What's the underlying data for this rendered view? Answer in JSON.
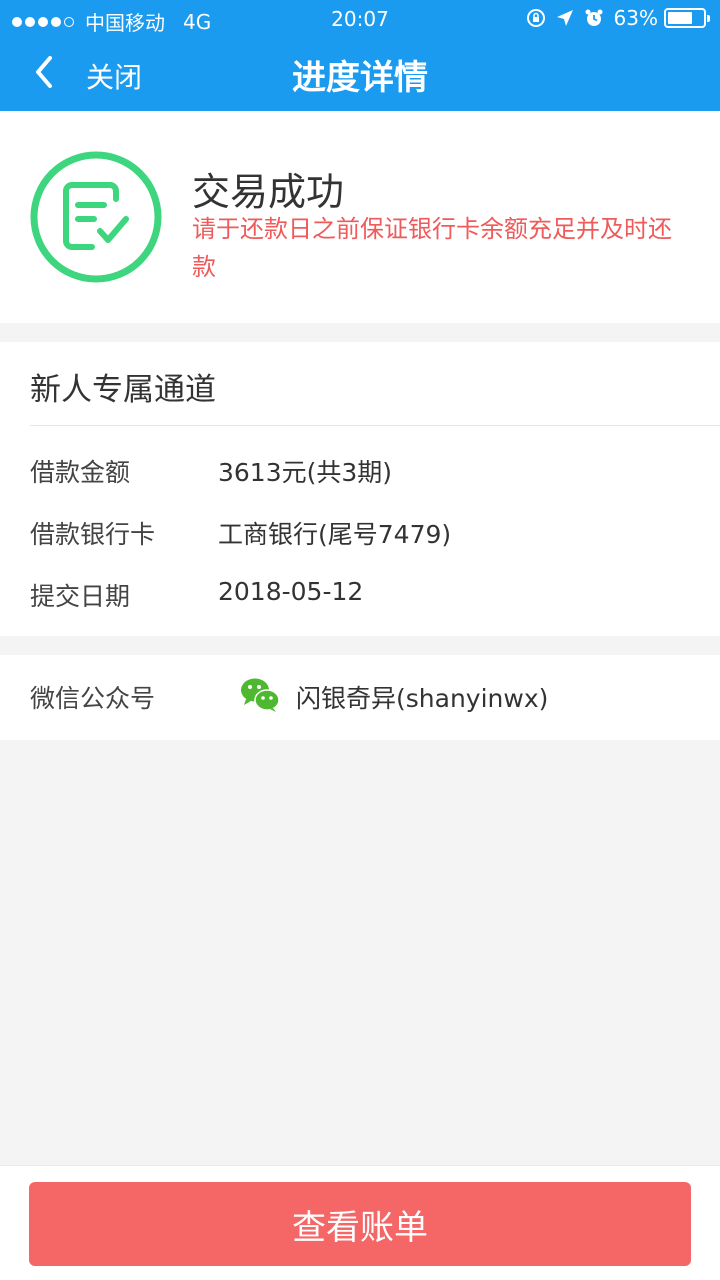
{
  "status_bar": {
    "carrier": "中国移动",
    "network": "4G",
    "time": "20:07",
    "battery": "63%"
  },
  "nav": {
    "close_label": "关闭",
    "title": "进度详情"
  },
  "result": {
    "title": "交易成功",
    "note": "请于还款日之前保证银行卡余额充足并及时还款"
  },
  "info": {
    "section_title": "新人专属通道",
    "rows": [
      {
        "label": "借款金额",
        "value": "3613元(共3期)"
      },
      {
        "label": "借款银行卡",
        "value": "工商银行(尾号7479)"
      },
      {
        "label": "提交日期",
        "value": "2018-05-12"
      }
    ]
  },
  "wechat": {
    "label": "微信公众号",
    "value": "闪银奇异(shanyinwx)"
  },
  "footer": {
    "button_label": "查看账单"
  },
  "colors": {
    "brand_blue": "#1a9bf0",
    "success_green": "#3dd57d",
    "alert_red": "#ef5a5a",
    "button_red": "#f56666",
    "wechat_green": "#4db830"
  }
}
